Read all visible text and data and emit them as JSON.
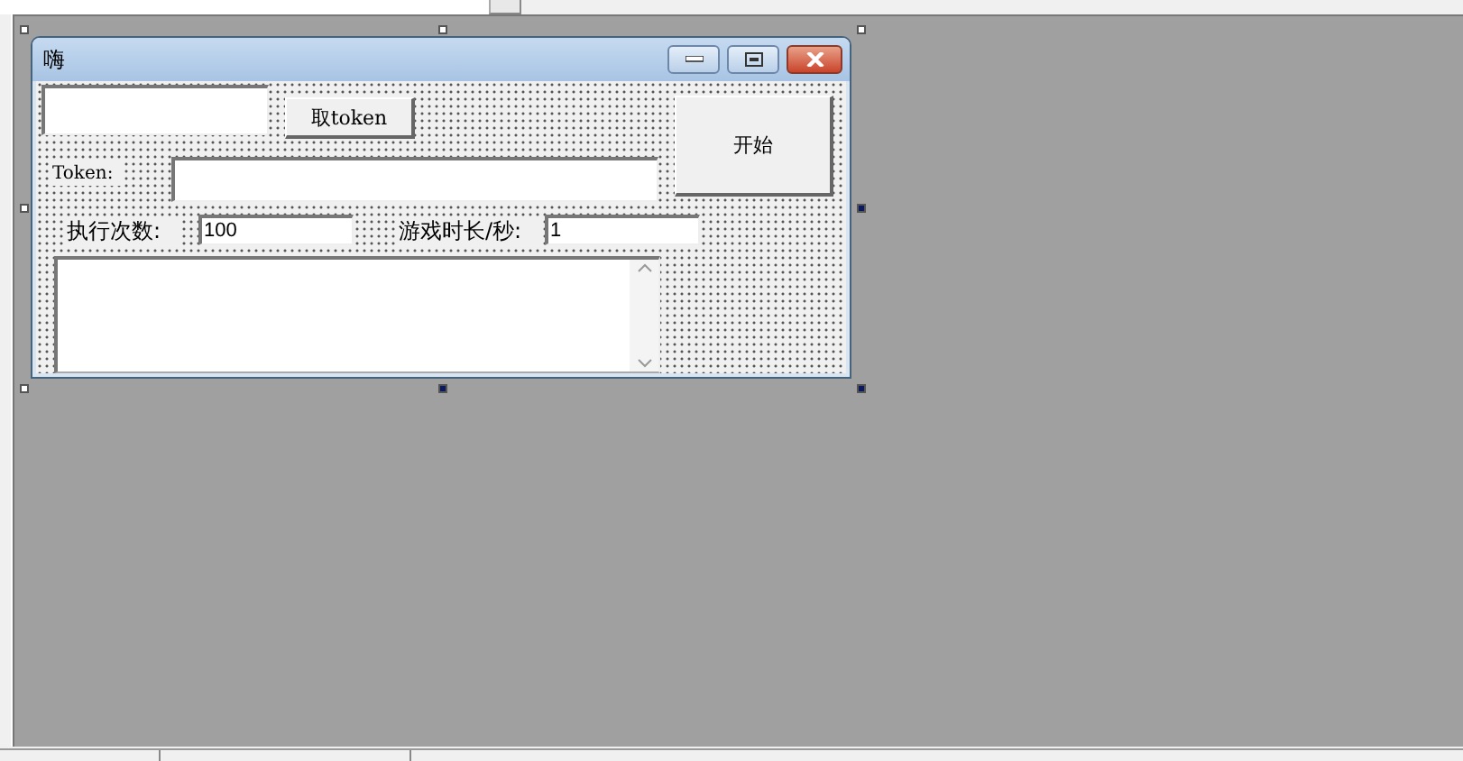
{
  "form_window": {
    "title": "嗨",
    "controls": [
      {
        "kind": "field"
      },
      {
        "kind": "button",
        "label": "取token"
      },
      {
        "kind": "button",
        "label": "开始"
      },
      {
        "kind": "label",
        "label": "Token:"
      },
      {
        "kind": "field"
      },
      {
        "kind": "label",
        "label": "执行次数:"
      },
      {
        "kind": "field",
        "value": "100"
      },
      {
        "kind": "label",
        "label": "游戏时长/秒:"
      },
      {
        "kind": "field",
        "value": "1"
      },
      {
        "kind": "memo"
      }
    ]
  }
}
